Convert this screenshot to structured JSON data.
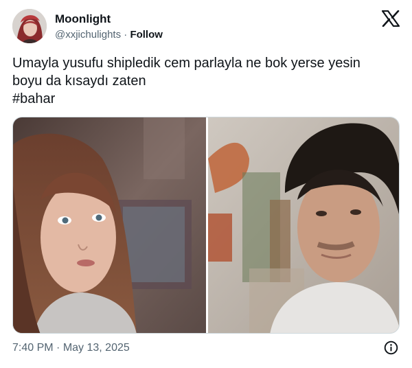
{
  "author": {
    "display_name": "Moonlight",
    "handle": "@xxjichulights",
    "separator": " · ",
    "follow_label": "Follow",
    "avatar_icon": "avatar-red-hair"
  },
  "platform_icon": "x-logo-icon",
  "tweet": {
    "lines": [
      "Umayla yusufu shipledik cem parlayla ne bok yerse yesin",
      "boyu da kısaydı zaten",
      "#bahar"
    ]
  },
  "media": {
    "count": 2
  },
  "footer": {
    "time": "7:40 PM",
    "date_separator": " · ",
    "date": "May 13, 2025",
    "info_icon": "info-circle-icon"
  },
  "colors": {
    "text_primary": "#0f1419",
    "text_secondary": "#536471",
    "border": "#cfd9de"
  }
}
